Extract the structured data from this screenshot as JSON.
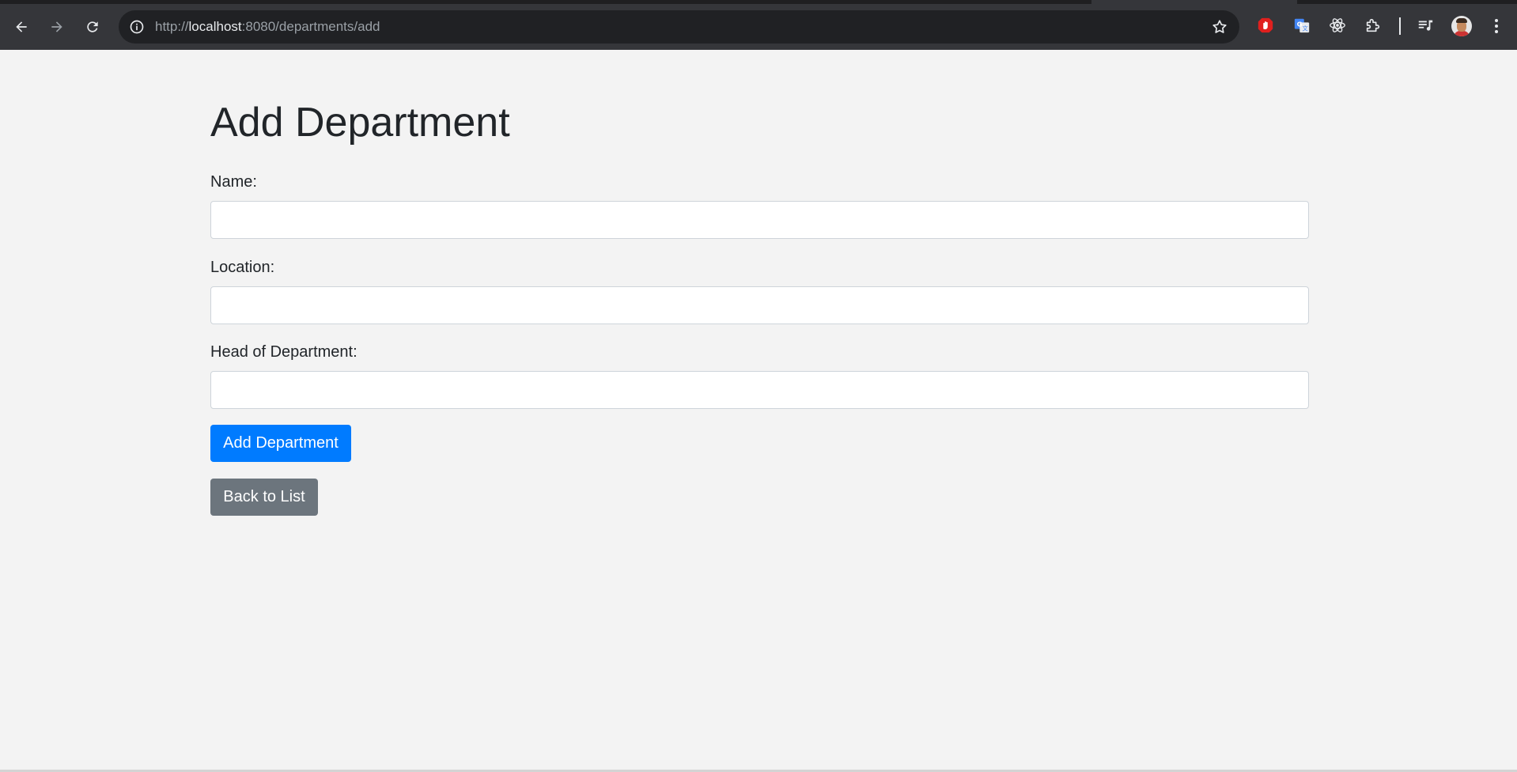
{
  "browser": {
    "url_scheme": "http://",
    "url_host": "localhost",
    "url_rest": ":8080/departments/add",
    "icons": {
      "back": "arrow-left-icon",
      "forward": "arrow-right-icon",
      "reload": "reload-icon",
      "site_info": "info-icon",
      "bookmark": "star-icon",
      "extensions": [
        "adblock-hand-icon",
        "translate-icon",
        "react-devtools-icon",
        "puzzle-piece-icon",
        "media-queue-icon"
      ],
      "menu": "kebab-menu-icon"
    }
  },
  "page": {
    "title": "Add Department",
    "form": {
      "name_label": "Name:",
      "name_value": "",
      "location_label": "Location:",
      "location_value": "",
      "head_label": "Head of Department:",
      "head_value": "",
      "submit_label": "Add Department"
    },
    "back_label": "Back to List"
  },
  "colors": {
    "primary": "#007bff",
    "secondary": "#6c757d",
    "page_bg": "#f3f3f3",
    "chrome_bg": "#35363a"
  }
}
